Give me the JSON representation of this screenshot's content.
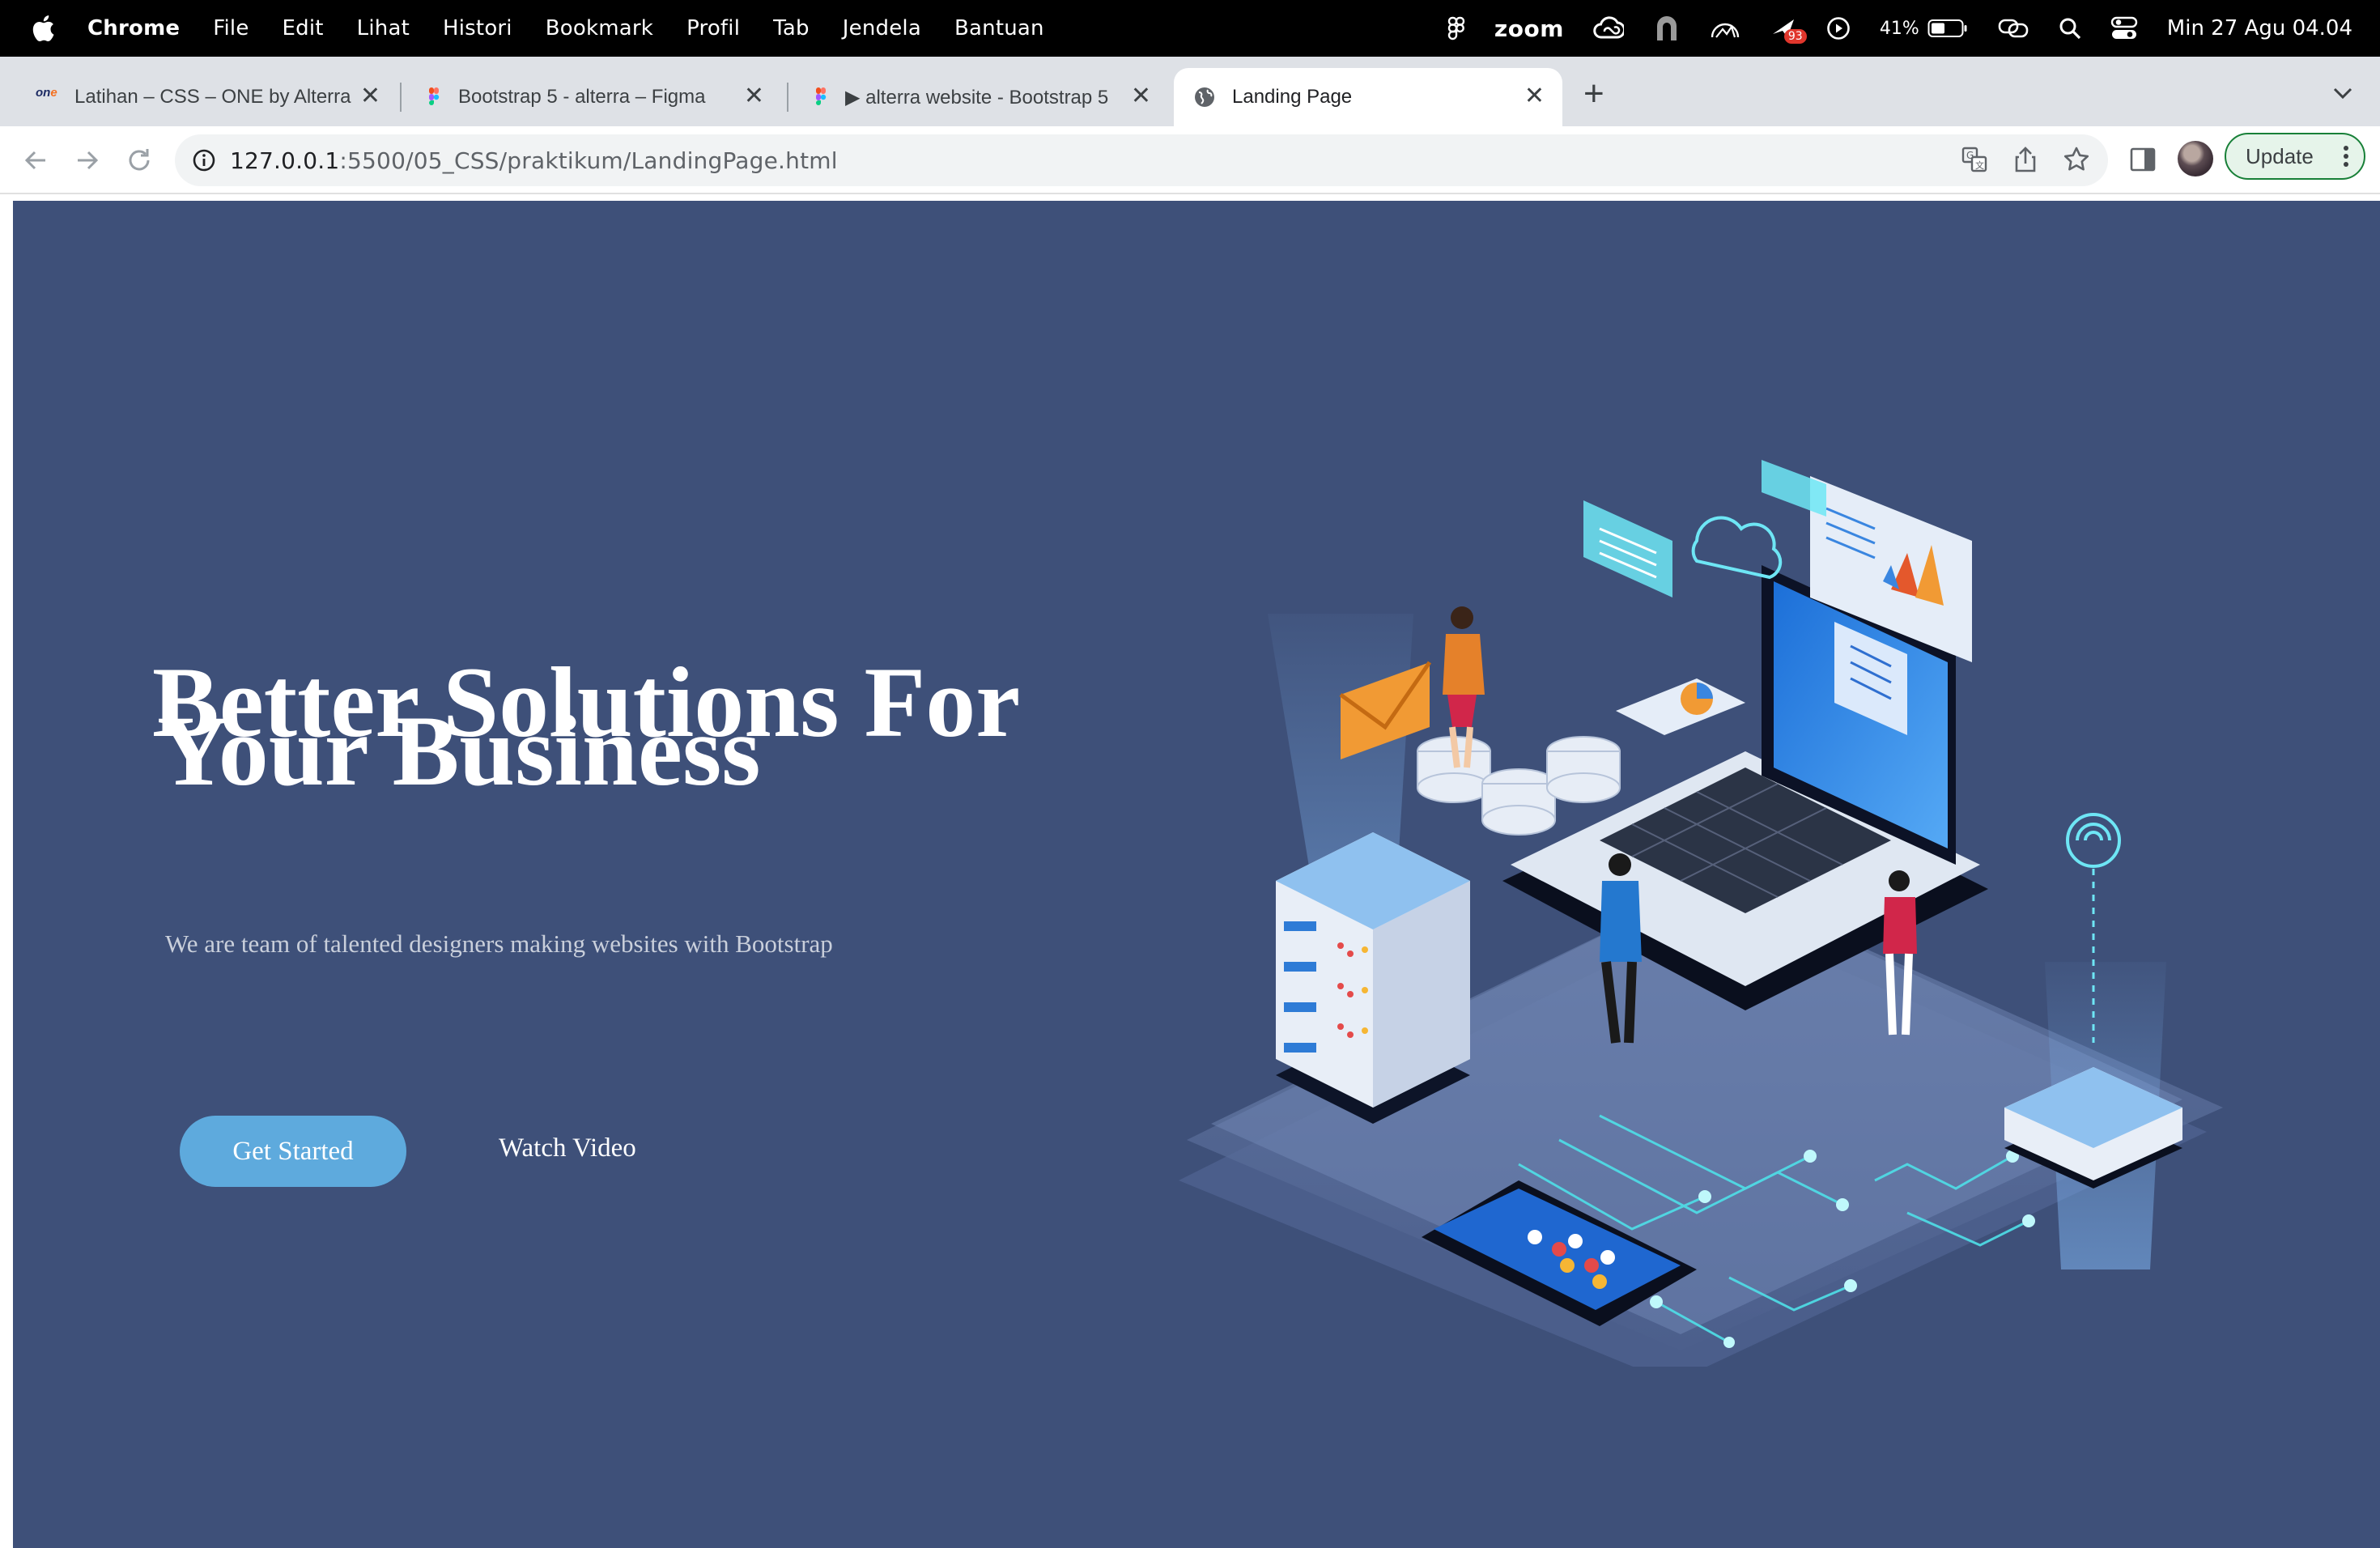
{
  "menubar": {
    "items": [
      "Chrome",
      "File",
      "Edit",
      "Lihat",
      "Histori",
      "Bookmark",
      "Profil",
      "Tab",
      "Jendela",
      "Bantuan"
    ],
    "zoom_label": "zoom",
    "notification_count": "93",
    "battery": "41%",
    "clock": "Min 27 Agu  04.04"
  },
  "tabs": [
    {
      "title": "Latihan – CSS – ONE by Alterra",
      "favicon": "one-logo"
    },
    {
      "title": "Bootstrap 5 - alterra – Figma",
      "favicon": "figma-icon"
    },
    {
      "title": "▶ alterra website - Bootstrap 5",
      "favicon": "figma-icon"
    },
    {
      "title": "Landing Page",
      "favicon": "globe-icon"
    }
  ],
  "omnibox": {
    "host": "127.0.0.1",
    "path": ":5500/05_CSS/praktikum/LandingPage.html"
  },
  "toolbar": {
    "update_label": "Update"
  },
  "hero": {
    "title_line1": "Better Solutions For",
    "title_line2": "Your Business",
    "subtitle": "We are team of talented designers making websites with Bootstrap",
    "cta_primary": "Get Started",
    "cta_secondary": "Watch Video"
  },
  "colors": {
    "hero_bg": "#3e5079",
    "cta_bg": "#5eaadd",
    "update_border": "#188038"
  }
}
